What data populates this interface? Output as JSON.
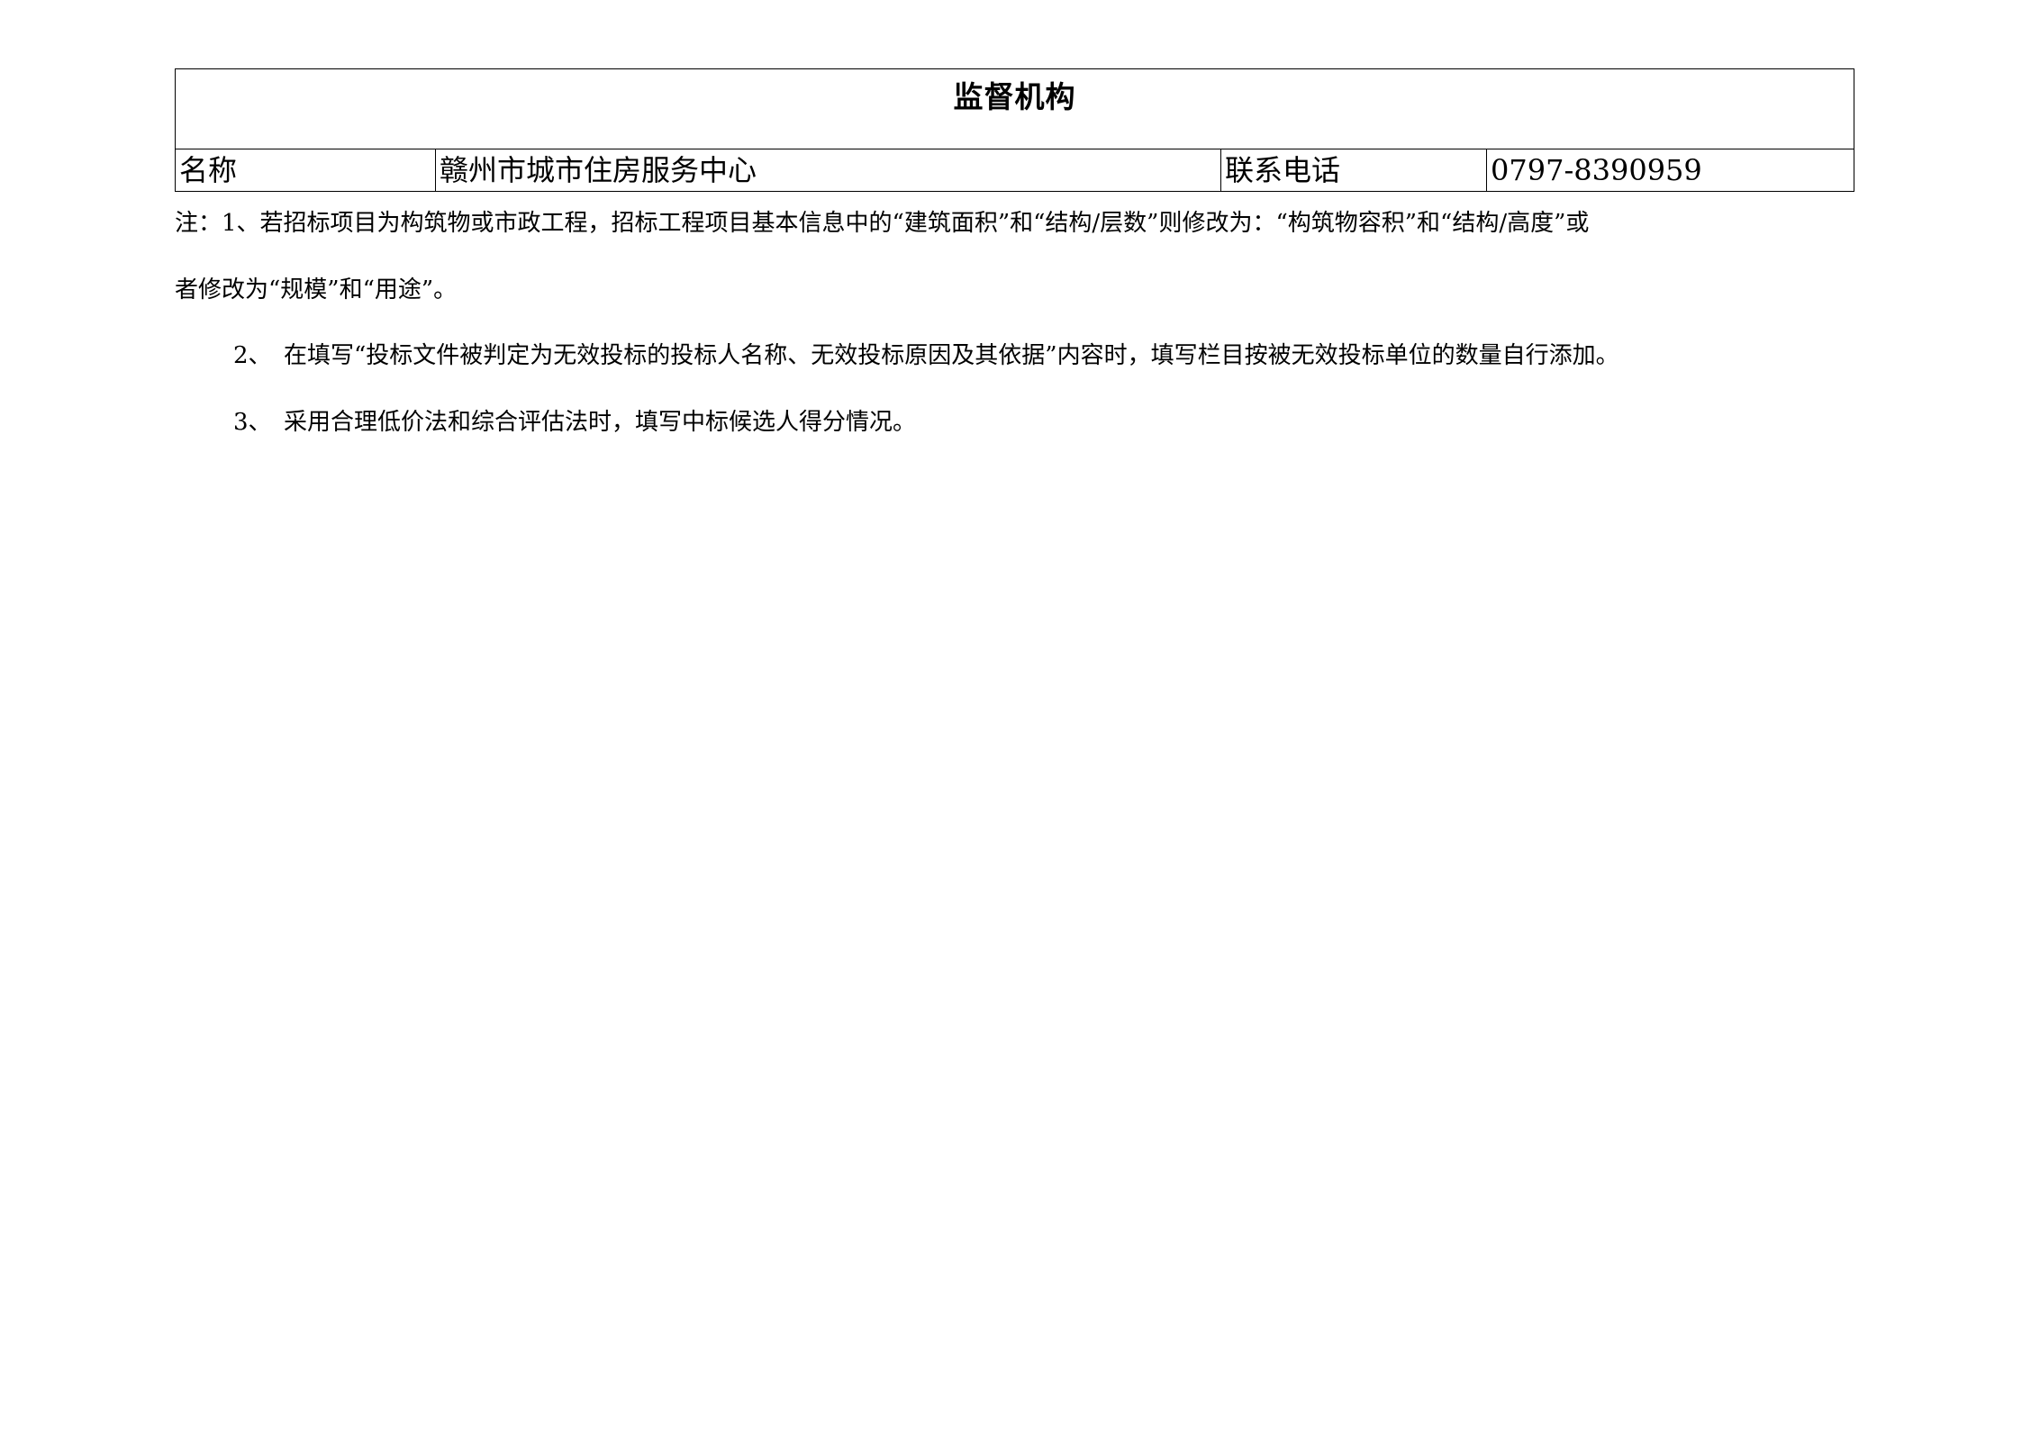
{
  "table": {
    "title": "监督机构",
    "name_label": "名称",
    "name_value": "赣州市城市住房服务中心",
    "phone_label": "联系电话",
    "phone_value": "0797-8390959"
  },
  "notes": {
    "note1_line1": "注：1、若招标项目为构筑物或市政工程，招标工程项目基本信息中的“建筑面积”和“结构/层数”则修改为：“构筑物容积”和“结构/高度”或",
    "note1_line2": "者修改为“规模”和“用途”。",
    "note2_num": "2、",
    "note2_text": "在填写“投标文件被判定为无效投标的投标人名称、无效投标原因及其依据”内容时，填写栏目按被无效投标单位的数量自行添加。",
    "note3_num": "3、",
    "note3_text": "采用合理低价法和综合评估法时，填写中标候选人得分情况。"
  }
}
